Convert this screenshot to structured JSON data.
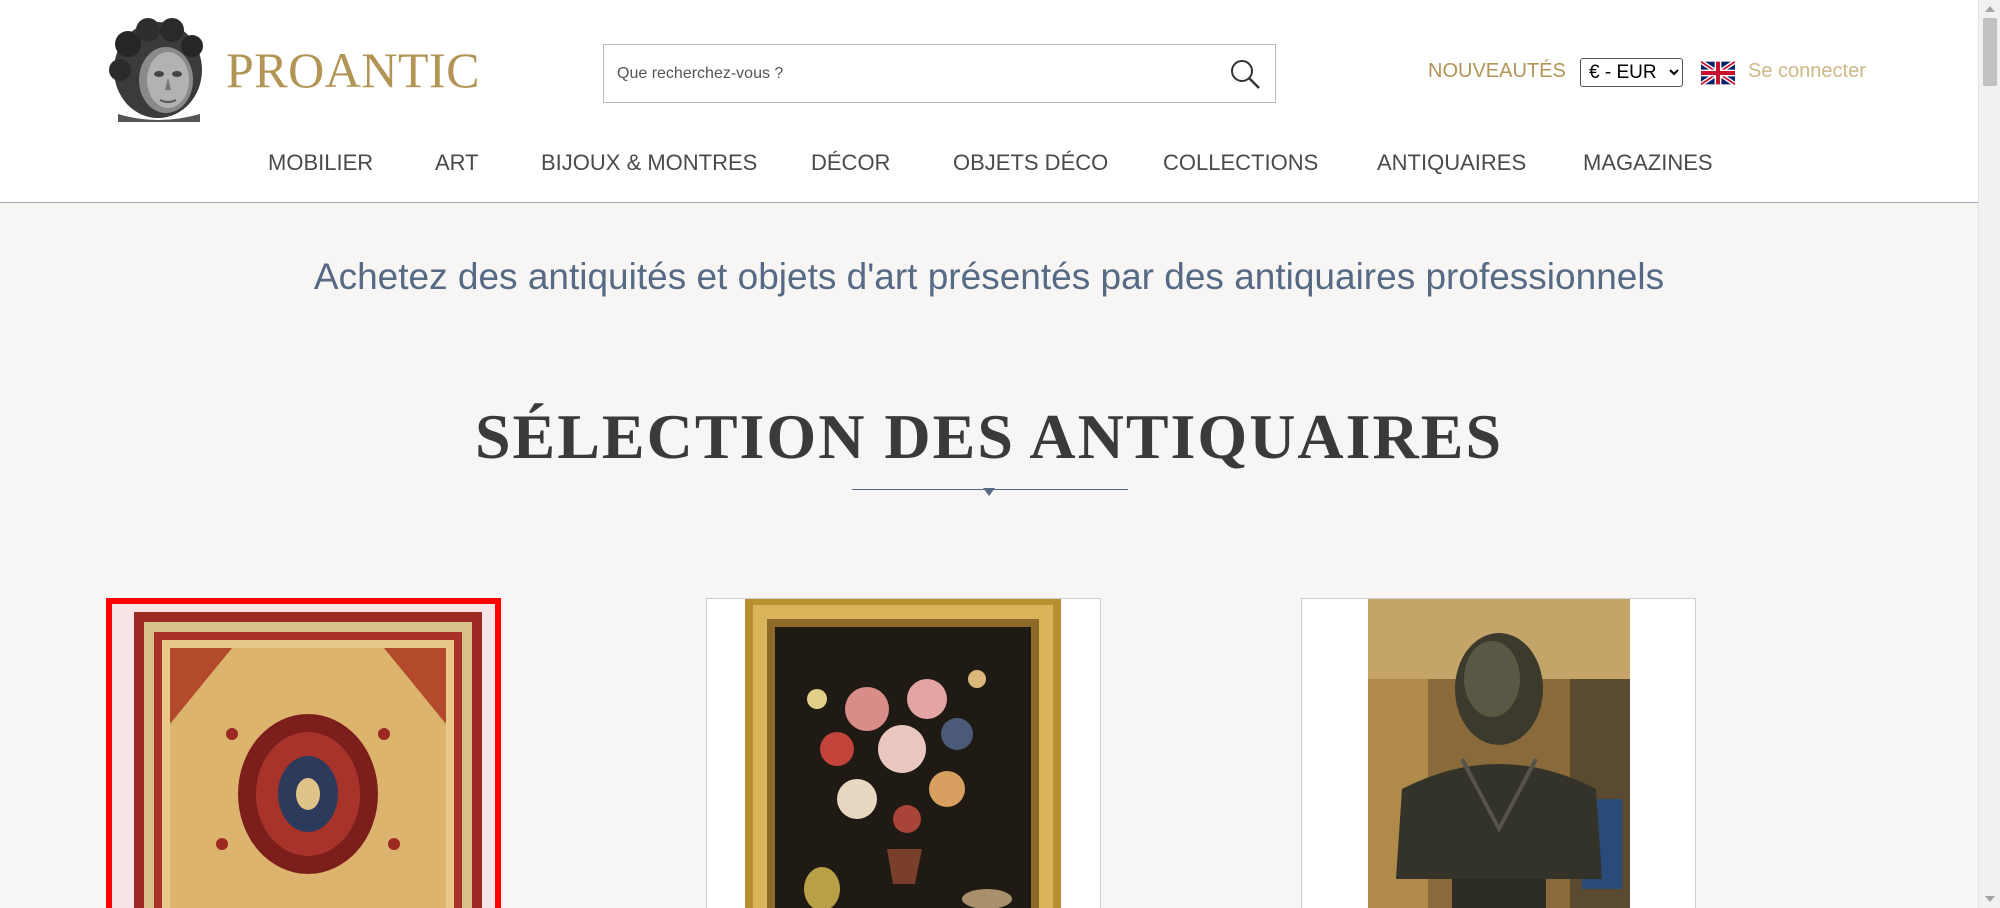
{
  "brand": {
    "name": "PROANTIC"
  },
  "search": {
    "placeholder": "Que recherchez-vous ?",
    "icon": "search-icon"
  },
  "topbar": {
    "nouveautes": "NOUVEAUTÉS",
    "currency": {
      "selected": "€ - EUR"
    },
    "language_icon": "uk-flag-icon",
    "login": "Se connecter"
  },
  "nav": {
    "items": [
      {
        "label": "MOBILIER"
      },
      {
        "label": "ART"
      },
      {
        "label": "BIJOUX & MONTRES"
      },
      {
        "label": "DÉCOR"
      },
      {
        "label": "OBJETS DÉCO"
      },
      {
        "label": "COLLECTIONS"
      },
      {
        "label": "ANTIQUAIRES"
      },
      {
        "label": "MAGAZINES"
      }
    ]
  },
  "tagline": "Achetez des antiquités et objets d'art présentés par des antiquaires professionnels",
  "section": {
    "title": "SÉLECTION DES ANTIQUAIRES"
  },
  "products": [
    {
      "icon": "persian-rug-image",
      "selected": true
    },
    {
      "icon": "flower-still-life-painting-image",
      "selected": false
    },
    {
      "icon": "bronze-bust-image",
      "selected": false
    }
  ],
  "colors": {
    "brand_gold": "#b29454",
    "login_gold": "#cdb886",
    "tagline_blue": "#566a85",
    "selection_outline": "#ff0000"
  }
}
